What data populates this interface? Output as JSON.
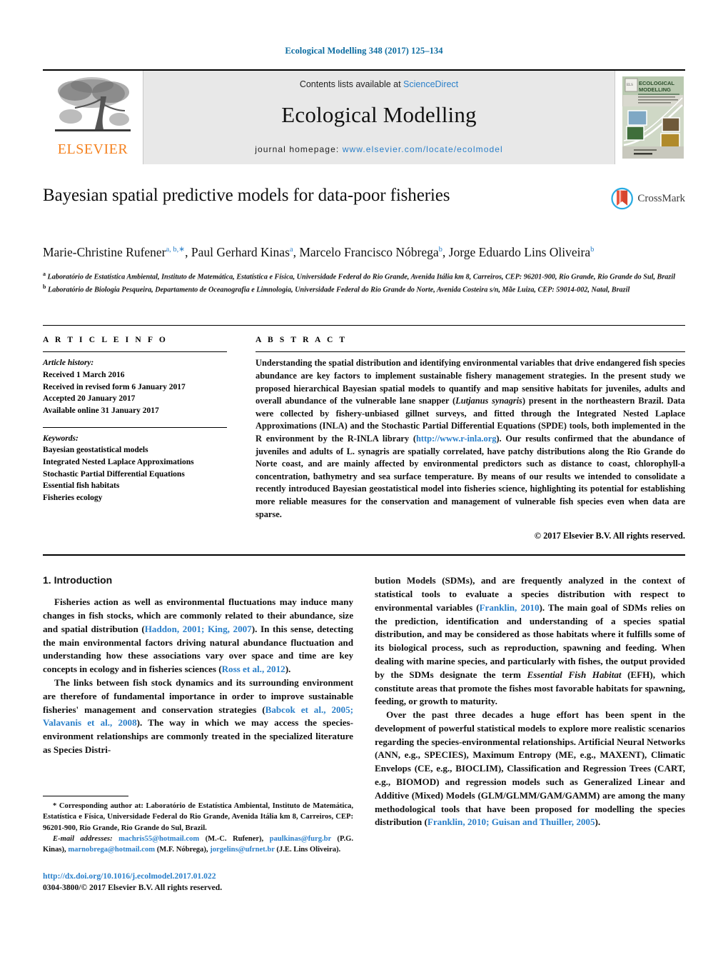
{
  "running_head": "Ecological Modelling 348 (2017) 125–134",
  "masthead": {
    "publisher_name": "ELSEVIER",
    "contents_prefix": "Contents lists available at ",
    "contents_link": "ScienceDirect",
    "journal_title": "Ecological Modelling",
    "homepage_prefix": "journal homepage: ",
    "homepage_url": "www.elsevier.com/locate/ecolmodel",
    "cover_title_line1": "ECOLOGICAL",
    "cover_title_line2": "MODELLING"
  },
  "article": {
    "title": "Bayesian spatial predictive models for data-poor fisheries",
    "crossmark_label": "CrossMark",
    "authors": [
      {
        "name": "Marie-Christine Rufener",
        "sup": "a, b,∗",
        "sep": ", "
      },
      {
        "name": "Paul Gerhard Kinas",
        "sup": "a",
        "sep": ", "
      },
      {
        "name": "Marcelo Francisco Nóbrega",
        "sup": "b",
        "sep": ", "
      },
      {
        "name": "Jorge Eduardo Lins Oliveira",
        "sup": "b",
        "sep": ""
      }
    ],
    "affiliations": [
      {
        "marker": "a",
        "text": "Laboratório de Estatística Ambiental, Instituto de Matemática, Estatística e Física, Universidade Federal do Rio Grande, Avenida Itália km 8, Carreiros, CEP: 96201-900, Rio Grande, Rio Grande do Sul, Brazil"
      },
      {
        "marker": "b",
        "text": "Laboratório de Biologia Pesqueira, Departamento de Oceanografia e Limnologia, Universidade Federal do Rio Grande do Norte, Avenida Costeira s/n, Mãe Luiza, CEP: 59014-002, Natal, Brazil"
      }
    ]
  },
  "article_info": {
    "heading": "A R T I C L E   I N F O",
    "history_label": "Article history:",
    "history": [
      "Received 1 March 2016",
      "Received in revised form 6 January 2017",
      "Accepted 20 January 2017",
      "Available online 31 January 2017"
    ],
    "keywords_label": "Keywords:",
    "keywords": [
      "Bayesian geostatistical models",
      "Integrated Nested Laplace Approximations",
      "Stochastic Partial Differential Equations",
      "Essential fish habitats",
      "Fisheries ecology"
    ]
  },
  "abstract": {
    "heading": "A B S T R A C T",
    "part1": "Understanding the spatial distribution and identifying environmental variables that drive endangered fish species abundance are key factors to implement sustainable fishery management strategies. In the present study we proposed hierarchical Bayesian spatial models to quantify and map sensitive habitats for juveniles, adults and overall abundance of the vulnerable lane snapper (",
    "species_italic": "Lutjanus synagris",
    "part2": ") present in the northeastern Brazil. Data were collected by fishery-unbiased gillnet surveys, and fitted through the Integrated Nested Laplace Approximations (INLA) and the Stochastic Partial Differential Equations (SPDE) tools, both implemented in the R environment by the R-INLA library (",
    "inla_url": "http://www.r-inla.org",
    "part3": "). Our results confirmed that the abundance of juveniles and adults of L. synagris are spatially correlated, have patchy distributions along the Rio Grande do Norte coast, and are mainly affected by environmental predictors such as distance to coast, chlorophyll-a concentration, bathymetry and sea surface temperature. By means of our results we intended to consolidate a recently introduced Bayesian geostatistical model into fisheries science, highlighting its potential for establishing more reliable measures for the conservation and management of vulnerable fish species even when data are sparse.",
    "copyright": "© 2017 Elsevier B.V. All rights reserved."
  },
  "introduction": {
    "heading": "1.  Introduction",
    "left_p1_a": "Fisheries action as well as environmental fluctuations may induce many changes in fish stocks, which are commonly related to their abundance, size and spatial distribution (",
    "left_p1_cite1": "Haddon, 2001; King, 2007",
    "left_p1_b": "). In this sense, detecting the main environmental factors driving natural abundance fluctuation and understanding how these associations vary over space and time are key concepts in ecology and in fisheries sciences (",
    "left_p1_cite2": "Ross et al., 2012",
    "left_p1_c": ").",
    "left_p2_a": "The links between fish stock dynamics and its surrounding environment are therefore of fundamental importance in order to improve sustainable fisheries' management and conservation strategies (",
    "left_p2_cite1": "Babcok et al., 2005; Valavanis et al., 2008",
    "left_p2_b": "). The way in which we may access the species-environment relationships are commonly treated in the specialized literature as Species Distri-",
    "right_p1_a": "bution Models (SDMs), and are frequently analyzed in the context of statistical tools to evaluate a species distribution with respect to environmental variables (",
    "right_p1_cite1": "Franklin, 2010",
    "right_p1_b": "). The main goal of SDMs relies on the prediction, identification and understanding of a species spatial distribution, and may be considered as those habitats where it fulfills some of its biological process, such as reproduction, spawning and feeding. When dealing with marine species, and particularly with fishes, the output provided by the SDMs designate the term ",
    "right_p1_italic": "Essential Fish Habitat",
    "right_p1_c": " (EFH), which constitute areas that promote the fishes most favorable habitats for spawning, feeding, or growth to maturity.",
    "right_p2_a": "Over the past three decades a huge effort has been spent in the development of powerful statistical models to explore more realistic scenarios regarding the species-environmental relationships. Artificial Neural Networks (ANN, e.g., SPECIES), Maximum Entropy (ME, e.g., MAXENT), Climatic Envelops (CE, e.g., BIOCLIM), Classification and Regression Trees (CART, e.g., BIOMOD) and regression models such as Generalized Linear and Additive (Mixed) Models (GLM/GLMM/GAM/GAMM) are among the many methodological tools that have been proposed for modelling the species distribution (",
    "right_p2_cite1": "Franklin, 2010; Guisan and Thuiller, 2005",
    "right_p2_b": ")."
  },
  "footnotes": {
    "corresponding_marker": "*",
    "corresponding_text": "Corresponding author at: Laboratório de Estatística Ambiental, Instituto de Matemática, Estatística e Física, Universidade Federal do Rio Grande, Avenida Itália km 8, Carreiros, CEP: 96201-900, Rio Grande, Rio Grande do Sul, Brazil.",
    "email_label": "E-mail addresses:",
    "emails": [
      {
        "address": "machris55@hotmail.com",
        "owner": " (M.-C. Rufener), "
      },
      {
        "address": "paulkinas@furg.br",
        "owner": " (P.G. Kinas), "
      },
      {
        "address": "marnobrega@hotmail.com",
        "owner": " (M.F. Nóbrega), "
      },
      {
        "address": "jorgelins@ufrnet.br",
        "owner": " (J.E. Lins Oliveira)."
      }
    ],
    "doi": "http://dx.doi.org/10.1016/j.ecolmodel.2017.01.022",
    "issn_line": "0304-3800/© 2017 Elsevier B.V. All rights reserved."
  },
  "colors": {
    "link": "#2a7fc9",
    "running_head": "#0b6ba0",
    "elsevier_orange": "#F58220",
    "masthead_bg": "#e8e8e8"
  }
}
